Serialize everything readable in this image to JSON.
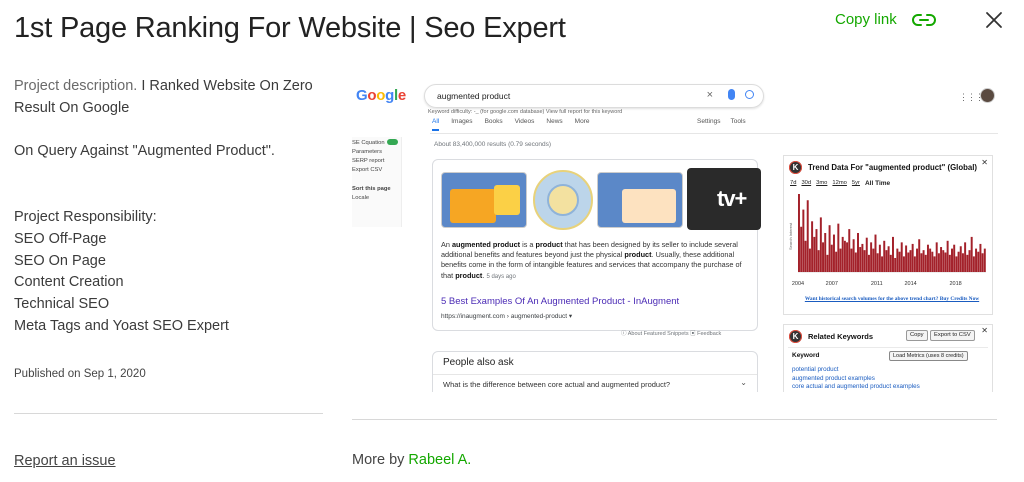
{
  "header": {
    "title": "1st Page Ranking For Website | Seo Expert",
    "copy_link_label": "Copy link"
  },
  "details": {
    "description_prefix": "Project description.",
    "description_line1": " I Ranked Website On Zero Result On Google",
    "description_line2": "On Query Against \"Augmented Product\".",
    "responsibility_lines": [
      "Project Responsibility:",
      "SEO Off-Page",
      "SEO On Page",
      "Content Creation",
      "Technical SEO",
      "Meta Tags and Yoast SEO Expert"
    ],
    "published": "Published on Sep 1, 2020",
    "report_label": "Report an issue"
  },
  "more_by": {
    "prefix": "More by ",
    "author": "Rabeel A."
  },
  "screenshot": {
    "logo_letters": [
      "G",
      "o",
      "o",
      "g",
      "l",
      "e"
    ],
    "search_query": "augmented product",
    "clear_glyph": "×",
    "kw_difficulty_line": "Keyword difficulty: -_  (for google.com database)    View full report for this keyword",
    "tabs": [
      "All",
      "Images",
      "Books",
      "Videos",
      "News",
      "More"
    ],
    "tabs_right": [
      "Settings",
      "Tools"
    ],
    "sidebar": {
      "toggle_label": "SE Cquation",
      "items": [
        "Parameters",
        "SERP report",
        "Export CSV"
      ],
      "sort_label": "Sort this page",
      "locale_label": "Locale"
    },
    "results_count": "About 83,400,000 results (0.79 seconds)",
    "tv_logo": "tv+",
    "snippet_parts": [
      {
        "t": "An ",
        "b": false
      },
      {
        "t": "augmented product",
        "b": true
      },
      {
        "t": " is a ",
        "b": false
      },
      {
        "t": "product",
        "b": true
      },
      {
        "t": " that has been designed by its seller to include several additional benefits and features beyond just the physical ",
        "b": false
      },
      {
        "t": "product",
        "b": true
      },
      {
        "t": ". Usually, these additional benefits come in the form of intangible features and services that accompany the purchase of that ",
        "b": false
      },
      {
        "t": "product",
        "b": true
      },
      {
        "t": ".",
        "b": false
      }
    ],
    "snippet_date": "5 days ago",
    "result_link": "5 Best Examples Of An Augmented Product - InAugment",
    "result_url": "https://inaugment.com › augmented-product ▾",
    "featured_line": "ⓘ About Featured Snippets    ▣ Feedback",
    "paa_title": "People also ask",
    "paa_question": "What is the difference between core actual and augmented product?",
    "trend": {
      "title": "Trend Data For \"augmented product\" (Global)",
      "ranges": [
        "7d",
        "30d",
        "3mo",
        "12mo",
        "5yr",
        "All Time"
      ],
      "y_label": "Search Interest",
      "link": "Want historical search volumes for the above trend chart? Buy Credits Now"
    },
    "related": {
      "title": "Related Keywords",
      "copy": "Copy",
      "export": "Export to CSV",
      "keyword_header": "Keyword",
      "load_button": "Load Metrics (uses 8 credits)",
      "keywords": [
        "potential product",
        "augmented product examples",
        "core actual and augmented product examples"
      ]
    }
  },
  "chart_data": {
    "type": "bar",
    "title": "Trend Data For \"augmented product\" (Global)",
    "xlabel": "",
    "ylabel": "Search Interest",
    "x_ticks": [
      "2004",
      "2007",
      "2011",
      "2014",
      "2018"
    ],
    "x_range": [
      2004,
      2020.7
    ],
    "ylim": [
      0,
      100
    ],
    "series": [
      {
        "color": "#a3212a",
        "values": [
          100,
          58,
          80,
          40,
          92,
          30,
          65,
          45,
          55,
          28,
          70,
          38,
          50,
          22,
          60,
          35,
          48,
          26,
          62,
          30,
          45,
          40,
          38,
          55,
          30,
          42,
          25,
          50,
          32,
          36,
          28,
          44,
          22,
          38,
          30,
          48,
          24,
          35,
          20,
          40,
          28,
          33,
          22,
          45,
          18,
          30,
          26,
          38,
          20,
          34,
          25,
          28,
          36,
          20,
          30,
          42,
          24,
          28,
          22,
          35,
          30,
          26,
          20,
          38,
          24,
          32,
          28,
          25,
          40,
          22,
          30,
          35,
          20,
          26,
          33,
          24,
          38,
          22,
          28,
          45,
          20,
          30,
          26,
          36,
          24,
          30
        ]
      }
    ]
  }
}
